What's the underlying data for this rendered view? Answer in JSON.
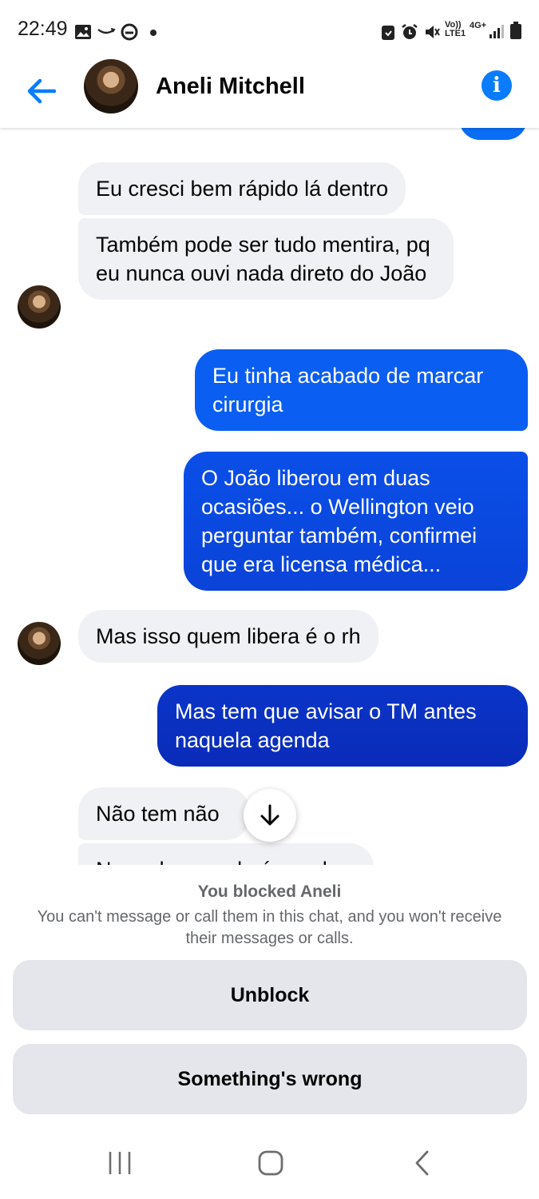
{
  "status_bar": {
    "time": "22:49",
    "lte_label": "LTE1",
    "signal_label": "4G+"
  },
  "header": {
    "contact_name": "Aneli Mitchell",
    "info_icon": "i"
  },
  "messages": [
    {
      "from": "them",
      "text": "Eu cresci bem rápido lá dentro"
    },
    {
      "from": "them",
      "text": "Também pode ser tudo mentira, pq eu nunca ouvi nada direto do João"
    },
    {
      "from": "me",
      "text": "Eu tinha acabado de marcar cirurgia"
    },
    {
      "from": "me",
      "text": "O João liberou em duas ocasiões... o Wellington veio perguntar também, confirmei que era licensa médica..."
    },
    {
      "from": "them",
      "text": "Mas isso quem libera é o rh"
    },
    {
      "from": "me",
      "text": "Mas tem que avisar o TM antes naquela agenda"
    },
    {
      "from": "them",
      "text": "Não tem não"
    },
    {
      "from": "them",
      "text": "Naquela agenda é pro rh"
    }
  ],
  "blocked": {
    "title": "You blocked Aneli",
    "description": "You can't message or call them in this chat, and you won't receive their messages or calls.",
    "unblock_label": "Unblock",
    "wrong_label": "Something's wrong"
  },
  "colors": {
    "accent": "#0a7cff",
    "incoming_bubble": "#f0f1f4",
    "button_bg": "#e4e6eb",
    "muted_text": "#65676b"
  },
  "icons": [
    "gallery-icon",
    "amazon-icon",
    "edge-icon",
    "battery-saver-icon",
    "alarm-icon",
    "mute-icon",
    "signal-icon",
    "battery-icon",
    "back-arrow-icon",
    "info-icon",
    "arrow-down-icon",
    "recents-icon",
    "home-icon",
    "nav-back-icon"
  ]
}
